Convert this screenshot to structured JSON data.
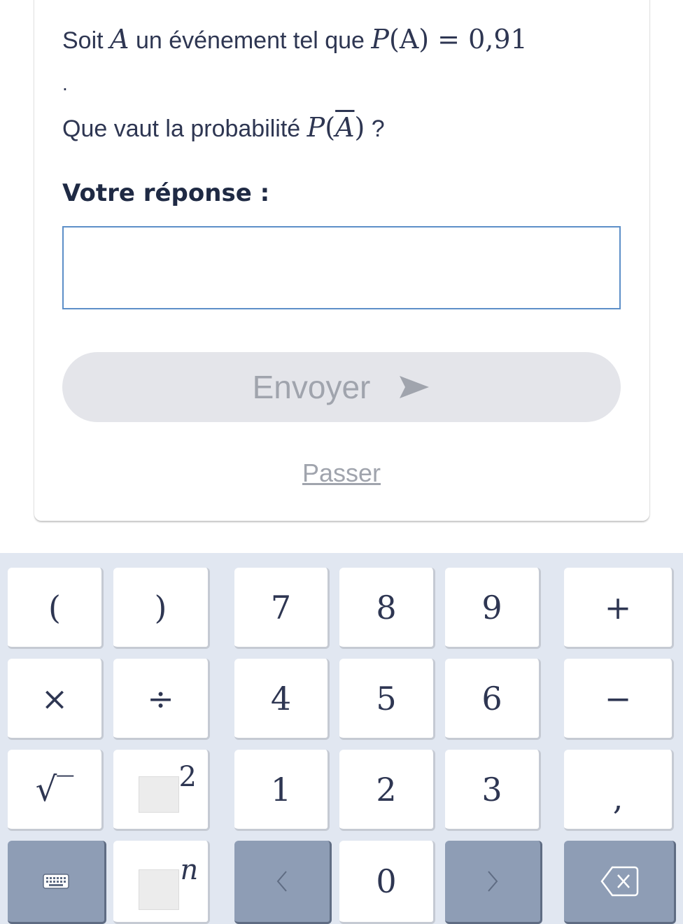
{
  "question": {
    "line1_prefix": "Soit ",
    "line1_var": "A",
    "line1_mid": " un événement tel que ",
    "line1_math_p": "P",
    "line1_math_arg": "(A)",
    "line1_math_eq": " = 0,91",
    "line1_dot": ".",
    "line2_prefix": "Que vaut la probabilité ",
    "line2_math_p": "P",
    "line2_math_arg": "A",
    "line2_suffix": " ?"
  },
  "answer": {
    "label": "Votre réponse :",
    "value": "",
    "placeholder": ""
  },
  "buttons": {
    "send_label": "Envoyer",
    "skip_label": "Passer"
  },
  "colors": {
    "text": "#2e3652",
    "input_border": "#5d8fc8",
    "button_bg": "#e4e5ea",
    "button_text": "#a0a4ad",
    "keypad_bg": "#e1e7f1",
    "key_dark": "#8e9db5"
  },
  "keypad": {
    "paren_open": "(",
    "paren_close": ")",
    "seven": "7",
    "eight": "8",
    "nine": "9",
    "plus": "+",
    "times": "×",
    "divide": "÷",
    "four": "4",
    "five": "5",
    "six": "6",
    "minus": "−",
    "sqrt": "√‾",
    "square_exp": "2",
    "one": "1",
    "two": "2",
    "three": "3",
    "comma": ",",
    "keyboard_icon": "keyboard-icon",
    "power_exp": "n",
    "left": "<",
    "zero": "0",
    "right": ">",
    "backspace_icon": "backspace-icon"
  }
}
